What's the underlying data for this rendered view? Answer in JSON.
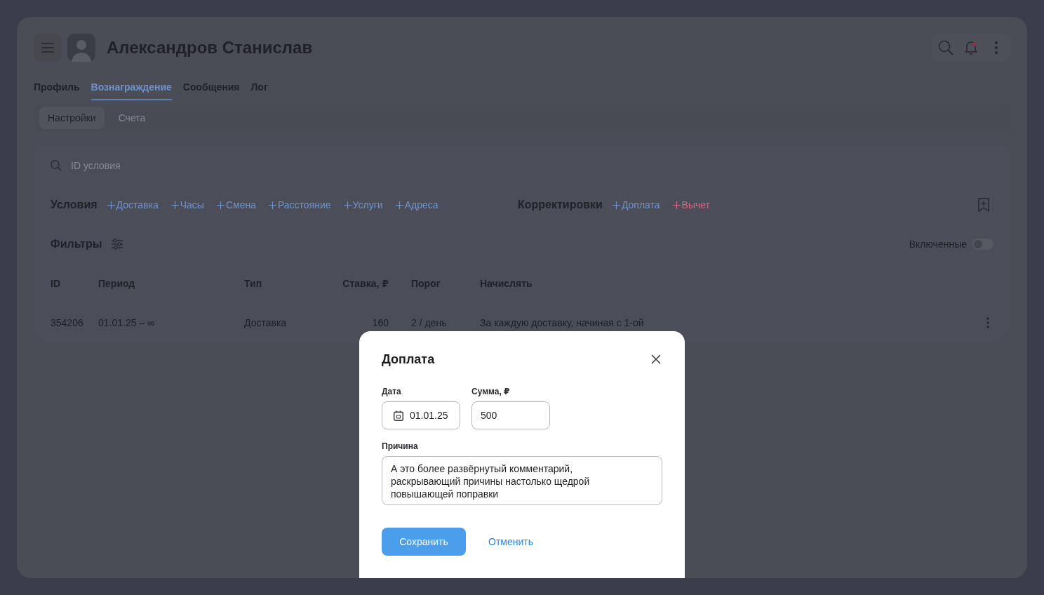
{
  "header": {
    "user_name": "Александров Станислав"
  },
  "tabs": [
    {
      "label": "Профиль",
      "selected": false
    },
    {
      "label": "Вознаграждение",
      "selected": true
    },
    {
      "label": "Сообщения",
      "selected": false
    },
    {
      "label": "Лог",
      "selected": false
    }
  ],
  "subtabs": [
    {
      "label": "Настройки",
      "selected": true
    },
    {
      "label": "Счета",
      "selected": false
    }
  ],
  "search": {
    "placeholder": "ID условия"
  },
  "conditions": {
    "title": "Условия",
    "actions": [
      {
        "label": "Доставка",
        "kind": "add"
      },
      {
        "label": "Часы",
        "kind": "add"
      },
      {
        "label": "Смена",
        "kind": "add"
      },
      {
        "label": "Расстояние",
        "kind": "add"
      },
      {
        "label": "Услуги",
        "kind": "add"
      },
      {
        "label": "Адреса",
        "kind": "add"
      }
    ]
  },
  "adjustments": {
    "title": "Корректировки",
    "actions": [
      {
        "label": "Доплата",
        "kind": "add"
      },
      {
        "label": "Вычет",
        "kind": "deduct"
      }
    ]
  },
  "filters": {
    "title": "Фильтры",
    "toggle": {
      "label": "Включенные",
      "on": false
    }
  },
  "table": {
    "columns": [
      "ID",
      "Период",
      "Тип",
      "Ставка, ₽",
      "Порог",
      "Начислять"
    ],
    "rows": [
      {
        "cells": [
          "354206",
          "01.01.25 – ∞",
          "Доставка",
          "160",
          "2 / день",
          "За каждую доставку, начиная с 1-ой"
        ]
      }
    ]
  },
  "dialog": {
    "title": "Доплата",
    "fields": [
      {
        "label": "Дата",
        "value": "01.01.25",
        "kind": "date"
      },
      {
        "label": "Сумма, ₽",
        "value": "500",
        "kind": "number"
      }
    ],
    "reason": {
      "label": "Причина",
      "value": "А это более развёрнутый комментарий, раскрывающий причины настолько щедрой повышающей поправки"
    },
    "buttons": [
      {
        "label": "Сохранить",
        "kind": "primary"
      },
      {
        "label": "Отменить",
        "kind": "link"
      }
    ]
  }
}
